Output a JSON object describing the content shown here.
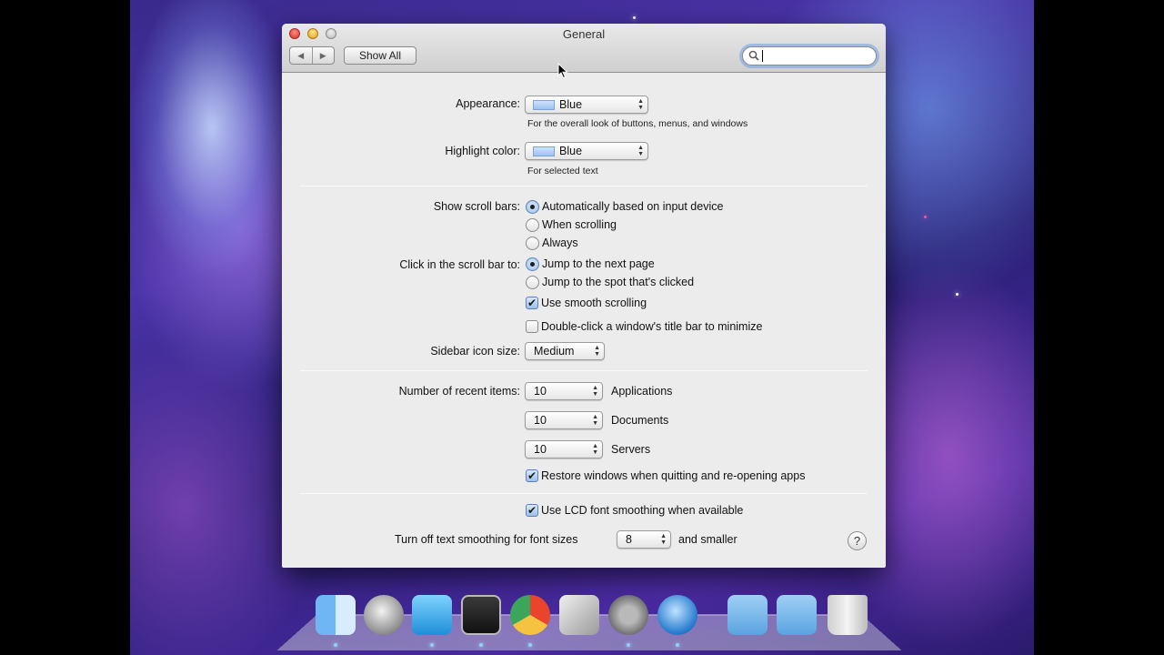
{
  "window": {
    "title": "General",
    "toolbar": {
      "back": "◀",
      "forward": "▶",
      "show_all": "Show All"
    },
    "search": {
      "placeholder": ""
    }
  },
  "appearance": {
    "label": "Appearance:",
    "value": "Blue",
    "description": "For the overall look of buttons, menus, and windows"
  },
  "highlight": {
    "label": "Highlight color:",
    "value": "Blue",
    "description": "For selected text"
  },
  "scroll_bars": {
    "label": "Show scroll bars:",
    "options": [
      "Automatically based on input device",
      "When scrolling",
      "Always"
    ],
    "selected": 0
  },
  "click_scroll": {
    "label": "Click in the scroll bar to:",
    "options": [
      "Jump to the next page",
      "Jump to the spot that's clicked"
    ],
    "selected": 0
  },
  "checks": {
    "smooth_scrolling": {
      "label": "Use smooth scrolling",
      "checked": true
    },
    "double_click": {
      "label": "Double-click a window's title bar to minimize",
      "checked": false
    },
    "restore_windows": {
      "label": "Restore windows when quitting and re-opening apps",
      "checked": true
    },
    "lcd_smoothing": {
      "label": "Use LCD font smoothing when available",
      "checked": true
    }
  },
  "sidebar_size": {
    "label": "Sidebar icon size:",
    "value": "Medium"
  },
  "recent_items": {
    "label": "Number of recent items:",
    "rows": [
      {
        "value": "10",
        "kind": "Applications"
      },
      {
        "value": "10",
        "kind": "Documents"
      },
      {
        "value": "10",
        "kind": "Servers"
      }
    ]
  },
  "text_smoothing": {
    "prefix": "Turn off text smoothing for font sizes",
    "value": "8",
    "suffix": "and smaller"
  },
  "help": "?",
  "check_glyph": "✔",
  "dock": [
    "finder-icon",
    "launchpad-icon",
    "twitter-icon",
    "terminal-icon",
    "chrome-icon",
    "utility-icon",
    "system-preferences-icon",
    "quicktime-icon",
    "applications-folder-icon",
    "documents-folder-icon",
    "trash-icon"
  ]
}
